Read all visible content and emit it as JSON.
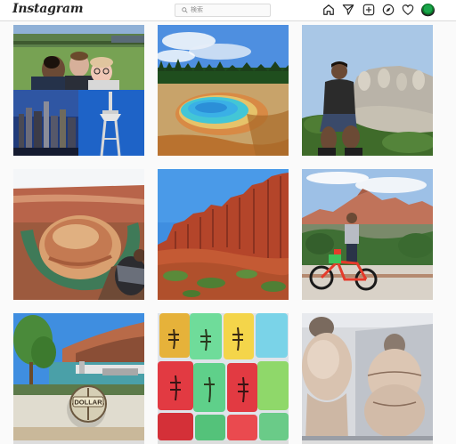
{
  "header": {
    "logo_text": "Instagram",
    "search_placeholder": "検索"
  },
  "nav_icons": [
    "home-icon",
    "direct-message-icon",
    "new-post-icon",
    "explore-icon",
    "activity-heart-icon",
    "profile-avatar"
  ],
  "posts": [
    {
      "name": "post-collage-selfie-seattle"
    },
    {
      "name": "post-hot-spring"
    },
    {
      "name": "post-mount-rushmore"
    },
    {
      "name": "post-horseshoe-bend"
    },
    {
      "name": "post-red-rocks"
    },
    {
      "name": "post-bike-mountains"
    },
    {
      "name": "post-pier-sign"
    },
    {
      "name": "post-scorpion-candy"
    },
    {
      "name": "post-mural"
    }
  ],
  "signs": {
    "dollar_sign_text": "DOLLAR"
  }
}
